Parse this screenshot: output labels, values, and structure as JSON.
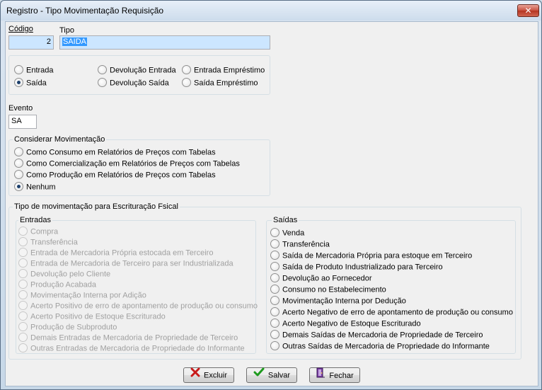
{
  "window": {
    "title": "Registro - Tipo Movimentação Requisição"
  },
  "fields": {
    "codigo_label": "Código",
    "codigo_value": "2",
    "tipo_label": "Tipo",
    "tipo_value": "SAIDA",
    "evento_label": "Evento",
    "evento_value": "SA"
  },
  "tipo_options": [
    {
      "label": "Entrada",
      "checked": false
    },
    {
      "label": "Saída",
      "checked": true
    },
    {
      "label": "Devolução Entrada",
      "checked": false
    },
    {
      "label": "Devolução Saída",
      "checked": false
    },
    {
      "label": "Entrada Empréstimo",
      "checked": false
    },
    {
      "label": "Saída Empréstimo",
      "checked": false
    }
  ],
  "considerar": {
    "title": "Considerar Movimentação",
    "options": [
      {
        "label": "Como Consumo em Relatórios de Preços com Tabelas",
        "checked": false
      },
      {
        "label": "Como Comercialização em Relatórios de Preços com Tabelas",
        "checked": false
      },
      {
        "label": "Como Produção em Relatórios de Preços com Tabelas",
        "checked": false
      },
      {
        "label": "Nenhum",
        "checked": true
      }
    ]
  },
  "fiscal": {
    "title": "Tipo de movimentação para Escrituração Fsical",
    "entradas": {
      "title": "Entradas",
      "items": [
        "Compra",
        "Transferência",
        "Entrada de Mercadoria Própria estocada em Terceiro",
        "Entrada de Mercadoria de Terceiro para ser Industrializada",
        "Devolução pelo Cliente",
        "Produção Acabada",
        "Movimentação Interna por Adição",
        "Acerto Positivo de erro de apontamento de produção ou consumo",
        "Acerto Positivo de Estoque Escriturado",
        "Produção de Subproduto",
        "Demais Entradas de Mercadoria de Propriedade de Terceiro",
        "Outras Entradas de Mercadoria de Propriedade do Informante"
      ]
    },
    "saidas": {
      "title": "Saídas",
      "items": [
        "Venda",
        "Transferência",
        "Saída de Mercadoria Própria para estoque em Terceiro",
        "Saída de Produto Industrializado para Terceiro",
        "Devolução ao Fornecedor",
        "Consumo no Estabelecimento",
        "Movimentação Interna por Dedução",
        "Acerto Negativo de erro de apontamento de produção ou consumo",
        "Acerto Negativo de Estoque Escriturado",
        "Demais Saídas de Mercadoria de Propriedade de Terceiro",
        "Outras Saídas de Mercadoria de Propriedade do Informante"
      ]
    }
  },
  "buttons": {
    "excluir": "Excluir",
    "salvar": "Salvar",
    "fechar": "Fechar"
  },
  "icons": {
    "close": "close-icon",
    "excluir": "red-x-icon",
    "salvar": "green-check-icon",
    "fechar": "door-exit-icon"
  }
}
